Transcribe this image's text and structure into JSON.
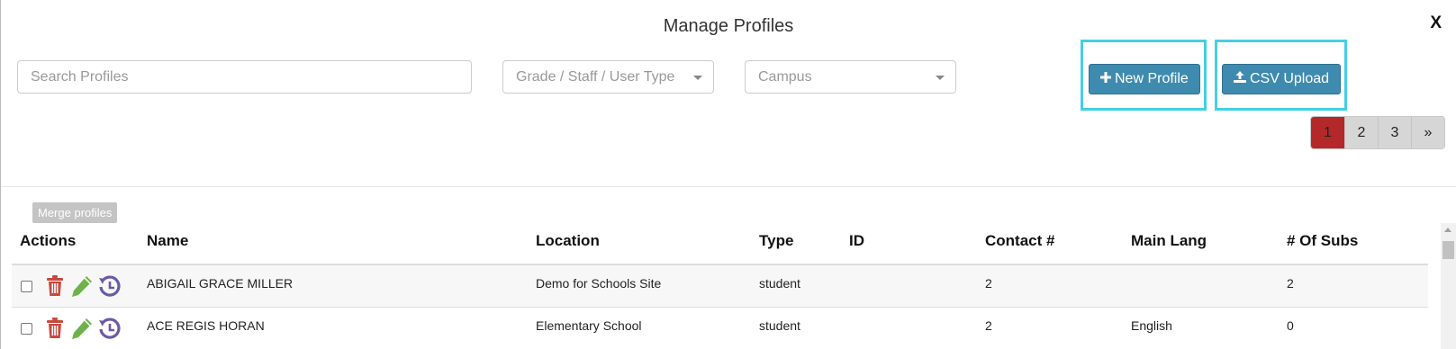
{
  "modal": {
    "title": "Manage Profiles",
    "close_label": "X"
  },
  "filters": {
    "search_placeholder": "Search Profiles",
    "type_select": "Grade / Staff / User Type",
    "campus_select": "Campus"
  },
  "buttons": {
    "new_profile": "New Profile",
    "csv_upload": "CSV Upload",
    "merge_profiles": "Merge profiles"
  },
  "pagination": {
    "pages": [
      "1",
      "2",
      "3"
    ],
    "next": "»",
    "active_page": "1"
  },
  "table": {
    "headers": {
      "actions": "Actions",
      "name": "Name",
      "location": "Location",
      "type": "Type",
      "id": "ID",
      "contact": "Contact #",
      "main_lang": "Main Lang",
      "subs": "# Of Subs"
    },
    "rows": [
      {
        "name": "ABIGAIL GRACE MILLER",
        "location": "Demo for Schools Site",
        "type": "student",
        "id": "",
        "contact": "2",
        "main_lang": "",
        "subs": "2"
      },
      {
        "name": "ACE REGIS HORAN",
        "location": "Elementary School",
        "type": "student",
        "id": "",
        "contact": "2",
        "main_lang": "English",
        "subs": "0"
      }
    ]
  },
  "colors": {
    "primary_button": "#3f8bb0",
    "highlight_outline": "#45cfe3",
    "active_page": "#b5282a",
    "delete_icon": "#c9493d",
    "edit_icon": "#6fb14a",
    "history_icon": "#6a5aa6"
  },
  "icons": {
    "delete": "trash-icon",
    "edit": "pencil-icon",
    "history": "history-icon",
    "plus": "plus-icon",
    "upload": "upload-icon"
  }
}
